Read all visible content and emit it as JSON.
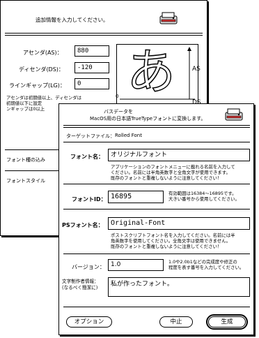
{
  "back_window": {
    "instruction": "追加情報を入力してください。",
    "ascent_label": "アセンダ(AS)：",
    "ascent_value": "880",
    "descent_label": "ディセンダ(DS)：",
    "descent_value": "-120",
    "linegap_label": "ラインギャップ(LG)：",
    "linegap_value": "0",
    "note": "アセンダは初期値以上、ディセンダは\n初期値以下に設定\nンギャップは0以上",
    "preview_char": "あ",
    "preview_as_label": "AS",
    "preview_ds_label": "DS",
    "preview_zero_label": "0",
    "font_embed_label": "フォント種の込み",
    "font_style_label": "フォントスタイル"
  },
  "front_window": {
    "header_line1": "バスデータを",
    "header_line2": "MacOS用の日本語TrueTypeフォントに変換します。",
    "target_file_label": "ターゲットファイル：",
    "target_file_value": "Rolled Font",
    "font_name_label": "フォント名：",
    "font_name_value": "オリジナルフォント",
    "font_name_help": "アプリケーションのフォントメニューに載れる名前を入力して\nください。名前には半角英数字と全角文字が使用できます。\n既存のフォントと重複しないように注意してください！",
    "font_id_label": "フォントID：",
    "font_id_value": "16895",
    "font_id_help": "有効範囲は16384～16895です。\n大きい番号から使用してください。",
    "ps_name_label": "PSフォント名：",
    "ps_name_value": "Original-Font",
    "ps_name_help": "ポストスクリプトフォント名を入力してください。名前には半\n角英数字を使用してください。全角文字は使用できません。\n既存のフォントと重複しないように注意してください！",
    "version_label": "バージョン：",
    "version_value": "1.0",
    "version_help": "1.0や2.0b1などの完成度や修正の\n程度を表す番号を入力してください。",
    "author_label": "文字制作者情報：\n(なるべく簡潔に)",
    "author_value": "私が作ったフォント。",
    "options_button": "オプション",
    "cancel_button": "中止",
    "create_button": "生成"
  }
}
